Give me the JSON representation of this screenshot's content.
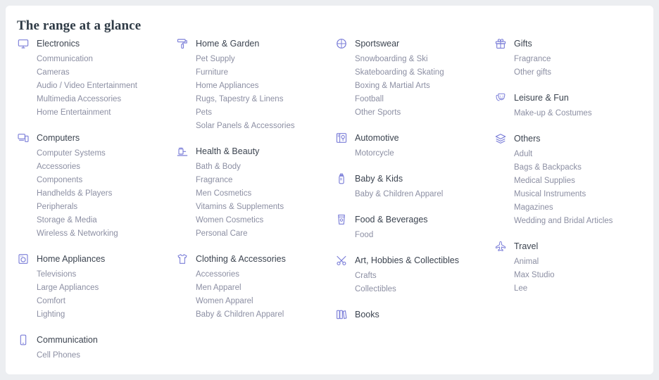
{
  "page": {
    "title": "The range at a glance",
    "card_background": "#ffffff",
    "page_background": "#eceef1",
    "icon_color": "#7b7ed8",
    "header_text_color": "#3c4450",
    "sub_text_color": "#8c8fa3"
  },
  "columns": [
    {
      "groups": [
        {
          "icon": "monitor-icon",
          "label": "Electronics",
          "items": [
            "Communication",
            "Cameras",
            "Audio / Video Entertainment",
            "Multimedia Accessories",
            "Home Entertainment"
          ]
        },
        {
          "icon": "computers-icon",
          "label": "Computers",
          "items": [
            "Computer Systems",
            "Accessories",
            "Components",
            "Handhelds & Players",
            "Peripherals",
            "Storage & Media",
            "Wireless & Networking"
          ]
        },
        {
          "icon": "washing-machine-icon",
          "label": "Home Appliances",
          "items": [
            "Televisions",
            "Large Appliances",
            "Comfort",
            "Lighting"
          ]
        },
        {
          "icon": "mobile-phone-icon",
          "label": "Communication",
          "items": [
            "Cell Phones"
          ]
        }
      ]
    },
    {
      "groups": [
        {
          "icon": "paint-roller-icon",
          "label": "Home & Garden",
          "items": [
            "Pet Supply",
            "Furniture",
            "Home Appliances",
            "Rugs, Tapestry & Linens",
            "Pets",
            "Solar Panels & Accessories"
          ]
        },
        {
          "icon": "toothbrush-icon",
          "label": "Health & Beauty",
          "items": [
            "Bath & Body",
            "Fragrance",
            "Men Cosmetics",
            "Vitamins & Supplements",
            "Women Cosmetics",
            "Personal Care"
          ]
        },
        {
          "icon": "tshirt-icon",
          "label": "Clothing & Accessories",
          "items": [
            "Accessories",
            "Men Apparel",
            "Women Apparel",
            "Baby & Children Apparel"
          ]
        }
      ]
    },
    {
      "groups": [
        {
          "icon": "basketball-icon",
          "label": "Sportswear",
          "items": [
            "Snowboarding & Ski",
            "Skateboarding & Skating",
            "Boxing & Martial Arts",
            "Football",
            "Other Sports"
          ]
        },
        {
          "icon": "car-door-icon",
          "label": "Automotive",
          "items": [
            "Motorcycle"
          ]
        },
        {
          "icon": "baby-bottle-icon",
          "label": "Baby & Kids",
          "items": [
            "Baby & Children Apparel"
          ]
        },
        {
          "icon": "coffee-cup-icon",
          "label": "Food & Beverages",
          "items": [
            "Food"
          ]
        },
        {
          "icon": "tools-icon",
          "label": "Art, Hobbies & Collectibles",
          "items": [
            "Crafts",
            "Collectibles"
          ]
        },
        {
          "icon": "books-icon",
          "label": "Books",
          "items": []
        }
      ]
    },
    {
      "groups": [
        {
          "icon": "gift-icon",
          "label": "Gifts",
          "items": [
            "Fragrance",
            "Other gifts"
          ]
        },
        {
          "icon": "theater-masks-icon",
          "label": "Leisure & Fun",
          "items": [
            "Make-up & Costumes"
          ]
        },
        {
          "icon": "layers-icon",
          "label": "Others",
          "items": [
            "Adult",
            "Bags & Backpacks",
            "Medical Supplies",
            "Musical Instruments",
            "Magazines",
            "Wedding and Bridal Articles"
          ]
        },
        {
          "icon": "airplane-icon",
          "label": "Travel",
          "items": [
            "Animal",
            "Max Studio",
            "Lee"
          ]
        }
      ]
    }
  ]
}
